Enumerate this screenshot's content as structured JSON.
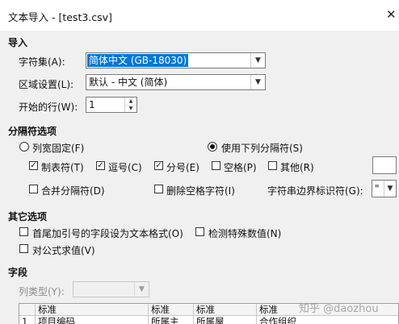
{
  "window": {
    "title": "文本导入 - [test3.csv]",
    "close_glyph": "✕"
  },
  "import_section": {
    "heading": "导入",
    "charset_label": "字符集(A):",
    "charset_value": "简体中文 (GB-18030)",
    "locale_label": "区域设置(L):",
    "locale_value": "默认 - 中文 (简体)",
    "start_row_label": "开始的行(W):",
    "start_row_value": "1"
  },
  "separator_section": {
    "heading": "分隔符选项",
    "fixed_width_label": "列宽固定(F)",
    "fixed_width_selected": false,
    "separated_by_label": "使用下列分隔符(S)",
    "separated_by_selected": true,
    "tab_label": "制表符(T)",
    "tab_checked": true,
    "comma_label": "逗号(C)",
    "comma_checked": true,
    "semicolon_label": "分号(E)",
    "semicolon_checked": true,
    "space_label": "空格(P)",
    "space_checked": false,
    "other_label": "其他(R)",
    "other_checked": false,
    "merge_label": "合并分隔符(D)",
    "merge_checked": false,
    "trim_label": "删除空格字符(I)",
    "trim_checked": false,
    "string_delim_label": "字符串边界标识符(G):",
    "string_delim_value": "\""
  },
  "other_section": {
    "heading": "其它选项",
    "quoted_as_text_label": "首尾加引号的字段设为文本格式(O)",
    "quoted_as_text_checked": false,
    "detect_numbers_label": "检测特殊数值(N)",
    "detect_numbers_checked": false,
    "evaluate_formulas_label": "对公式求值(V)",
    "evaluate_formulas_checked": false
  },
  "fields_section": {
    "heading": "字段",
    "column_type_label": "列类型(Y):",
    "column_type_value": ""
  },
  "preview": {
    "header": [
      "",
      "标准",
      "标准",
      "标准",
      "标准"
    ],
    "first_row": [
      "1",
      "项目编码",
      "所属主",
      "所属屋",
      "合作组织"
    ]
  },
  "watermark": "知乎 @daozhou"
}
